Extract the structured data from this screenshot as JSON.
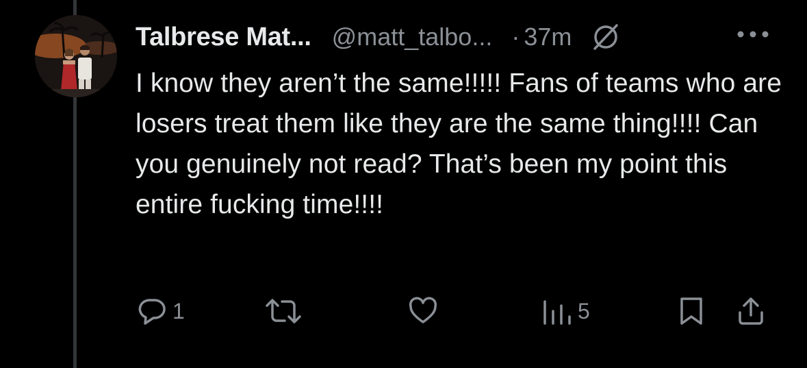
{
  "post": {
    "display_name": "Talbrese Mat...",
    "handle": "@matt_talbo...",
    "separator": "·",
    "time": "37m",
    "text": "I know they aren’t the same!!!!! Fans of teams who are losers treat them like they are the same thing!!!! Can you genuinely not read? That’s been my point this entire fucking time!!!!",
    "badge_icon": "no-entry-slash-icon",
    "more_icon": "more-dots-icon"
  },
  "actions": {
    "reply_count": "1",
    "retweet_count": "",
    "like_count": "",
    "views_count": "5"
  },
  "colors": {
    "background": "#000000",
    "text": "#e7e9ea",
    "muted": "#8b9096",
    "thread_line": "#333639"
  }
}
